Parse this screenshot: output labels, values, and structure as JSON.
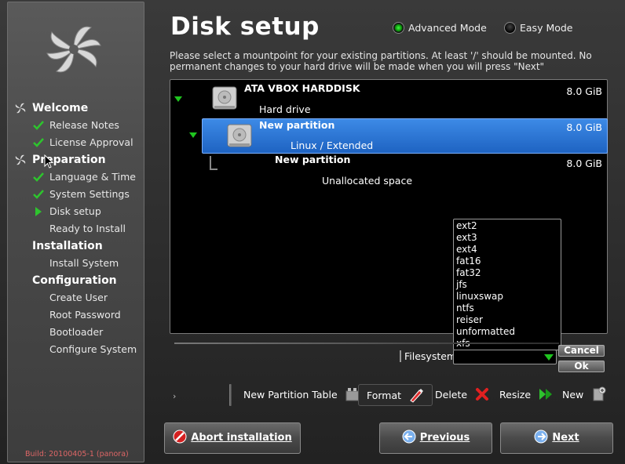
{
  "sidebar": {
    "sections": [
      {
        "label": "Welcome",
        "items": [
          {
            "label": "Release Notes",
            "status": "done"
          },
          {
            "label": "License Approval",
            "status": "done"
          }
        ]
      },
      {
        "label": "Preparation",
        "items": [
          {
            "label": "Language & Time",
            "status": "done"
          },
          {
            "label": "System Settings",
            "status": "done"
          },
          {
            "label": "Disk setup",
            "status": "current"
          },
          {
            "label": "Ready to Install",
            "status": "pending"
          }
        ]
      },
      {
        "label": "Installation",
        "items": [
          {
            "label": "Install System",
            "status": "pending"
          }
        ]
      },
      {
        "label": "Configuration",
        "items": [
          {
            "label": "Create User",
            "status": "pending"
          },
          {
            "label": "Root Password",
            "status": "pending"
          },
          {
            "label": "Bootloader",
            "status": "pending"
          },
          {
            "label": "Configure System",
            "status": "pending"
          }
        ]
      }
    ],
    "build": "Build: 20100405-1 (panora)"
  },
  "header": {
    "title": "Disk setup",
    "mode_advanced": "Advanced Mode",
    "mode_easy": "Easy Mode",
    "mode_selected": "Advanced Mode"
  },
  "intro": "Please select a mountpoint for your existing partitions. At least '/' should be mounted. No permanent changes to your hard drive will be made when you will press \"Next\"",
  "tree": {
    "disk": {
      "name": "ATA VBOX HARDDISK",
      "type": "Hard drive",
      "size": "8.0 GiB"
    },
    "partition": {
      "name": "New partition",
      "type": "Linux / Extended",
      "size": "8.0 GiB"
    },
    "unallocated": {
      "name": "New partition",
      "type": "Unallocated space",
      "size": "8.0 GiB"
    }
  },
  "filesystems": [
    "ext2",
    "ext3",
    "ext4",
    "fat16",
    "fat32",
    "jfs",
    "linuxswap",
    "ntfs",
    "reiser",
    "unformatted",
    "xfs"
  ],
  "form": {
    "filesystem_label": "Filesystem",
    "filesystem_value": "",
    "cancel": "Cancel",
    "ok": "Ok"
  },
  "toolbar": {
    "new_table": "New Partition Table",
    "format": "Format",
    "delete": "Delete",
    "resize": "Resize",
    "new": "New"
  },
  "footer": {
    "abort": "Abort installation",
    "previous": "Previous",
    "next": "Next"
  },
  "colors": {
    "accent_green": "#1fc41f",
    "selection_blue": "#2a72d4",
    "build_text": "#dd6666"
  }
}
